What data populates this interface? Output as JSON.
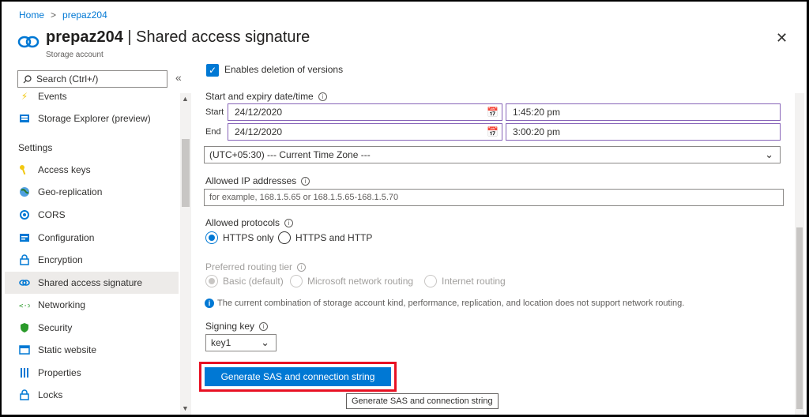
{
  "breadcrumb": {
    "home": "Home",
    "sep": ">",
    "current": "prepaz204"
  },
  "header": {
    "resource": "prepaz204",
    "divider": " | ",
    "page": "Shared access signature",
    "subtitle": "Storage account",
    "close": "✕"
  },
  "sidebar": {
    "search_placeholder": "Search (Ctrl+/)",
    "collapse": "«",
    "top_items": [
      {
        "label": "Events",
        "icon": "lightning-icon"
      },
      {
        "label": "Storage Explorer (preview)",
        "icon": "storage-explorer-icon"
      }
    ],
    "section": "Settings",
    "items": [
      {
        "label": "Access keys",
        "icon": "key-icon"
      },
      {
        "label": "Geo-replication",
        "icon": "globe-icon"
      },
      {
        "label": "CORS",
        "icon": "cors-icon"
      },
      {
        "label": "Configuration",
        "icon": "configuration-icon"
      },
      {
        "label": "Encryption",
        "icon": "lock-icon"
      },
      {
        "label": "Shared access signature",
        "icon": "link-icon",
        "active": true
      },
      {
        "label": "Networking",
        "icon": "networking-icon"
      },
      {
        "label": "Security",
        "icon": "shield-icon"
      },
      {
        "label": "Static website",
        "icon": "website-icon"
      },
      {
        "label": "Properties",
        "icon": "properties-icon"
      },
      {
        "label": "Locks",
        "icon": "lock-icon"
      }
    ]
  },
  "main": {
    "versions_checkbox": "Enables deletion of versions",
    "datetime_label": "Start and expiry date/time",
    "start_label": "Start",
    "end_label": "End",
    "start_date": "24/12/2020",
    "start_time": "1:45:20 pm",
    "end_date": "24/12/2020",
    "end_time": "3:00:20 pm",
    "timezone": "(UTC+05:30) --- Current Time Zone ---",
    "ip_label": "Allowed IP addresses",
    "ip_placeholder": "for example, 168.1.5.65 or 168.1.5.65-168.1.5.70",
    "protocols_label": "Allowed protocols",
    "protocol_options": [
      "HTTPS only",
      "HTTPS and HTTP"
    ],
    "routing_label": "Preferred routing tier",
    "routing_options": [
      "Basic (default)",
      "Microsoft network routing",
      "Internet routing"
    ],
    "routing_note": "The current combination of storage account kind, performance, replication, and location does not support network routing.",
    "signing_label": "Signing key",
    "signing_value": "key1",
    "generate_button": "Generate SAS and connection string",
    "tooltip": "Generate SAS and connection string"
  },
  "colors": {
    "accent": "#0078d4",
    "highlight": "#e81123",
    "field_border": "#8764b8"
  }
}
